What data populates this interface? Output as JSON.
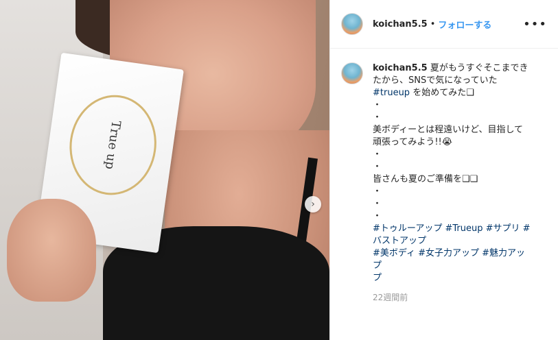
{
  "post": {
    "username": "koichan5.5",
    "separator": "•",
    "follow_label": "フォローする",
    "more_label": "•••"
  },
  "photo": {
    "pouch_label": "True up",
    "next_icon": "›"
  },
  "caption": {
    "username": "koichan5.5",
    "line1": "夏がもうすぐそこまでき",
    "line2": "たから、SNSで気になっていた",
    "line3_tag": "#trueup",
    "line3_text": " を始めてみた❑",
    "dots1": [
      "・",
      "・"
    ],
    "line4": "美ボディーとは程遠いけど、目指して",
    "line5": "頑張ってみよう!!😭",
    "dots2": [
      "・",
      "・"
    ],
    "line6": "皆さんも夏のご準備を❑❑",
    "dots3": [
      "・",
      "・",
      "・"
    ],
    "tags_line1": "#トゥルーアップ #Trueup #サプリ #",
    "tags_line2": "バストアップ",
    "tags_line3": "#美ボディ #女子力アップ #魅力アップ",
    "tags_line4": "プ"
  },
  "timestamp": "22週間前",
  "colors": {
    "follow": "#3897f0",
    "hashtag": "#003569",
    "muted": "#999999"
  }
}
